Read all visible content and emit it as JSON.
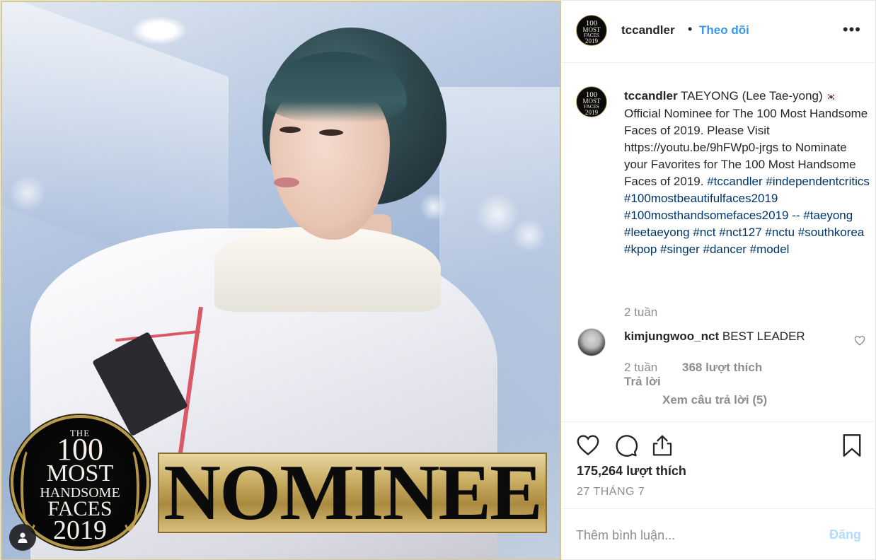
{
  "post": {
    "badge": {
      "the": "THE",
      "number": "100",
      "most": "MOST",
      "handsome": "HANDSOME",
      "faces": "FACES",
      "year": "2019"
    },
    "banner_text": "NOMINEE"
  },
  "header": {
    "username": "tccandler",
    "separator": "•",
    "follow_label": "Theo dõi",
    "more_label": "•••"
  },
  "caption": {
    "username": "tccandler",
    "body_line1": "TAEYONG (Lee Tae-yong)",
    "flag": "🇰🇷",
    "body_rest": "Official Nominee for The 100 Most Handsome Faces of 2019. Please Visit https://youtu.be/9hFWp0-jrgs to Nominate your Favorites for The 100 Most Handsome Faces of 2019.",
    "hashtags": "#tccandler #independentcritics #100mostbeautifulfaces2019 #100mosthandsomefaces2019 -- #taeyong #leetaeyong #nct #nct127 #nctu #southkorea #kpop #singer #dancer #model",
    "time": "2 tuần"
  },
  "comment": {
    "username": "kimjungwoo_nct",
    "text": "BEST LEADER",
    "time": "2 tuần",
    "likes": "368 lượt thích",
    "reply_label": "Trả lời",
    "view_replies": "Xem câu trả lời (5)"
  },
  "actions": {
    "icons": [
      "heart-icon",
      "comment-icon",
      "share-icon",
      "bookmark-icon"
    ],
    "likes": "175,264 lượt thích",
    "date": "27 THÁNG 7"
  },
  "add_comment": {
    "placeholder": "Thêm bình luận...",
    "post_label": "Đăng"
  },
  "colors": {
    "link_blue": "#3897f0",
    "hashtag": "#003569",
    "muted": "#8e8e8e",
    "post_disabled": "#b3dbff"
  }
}
